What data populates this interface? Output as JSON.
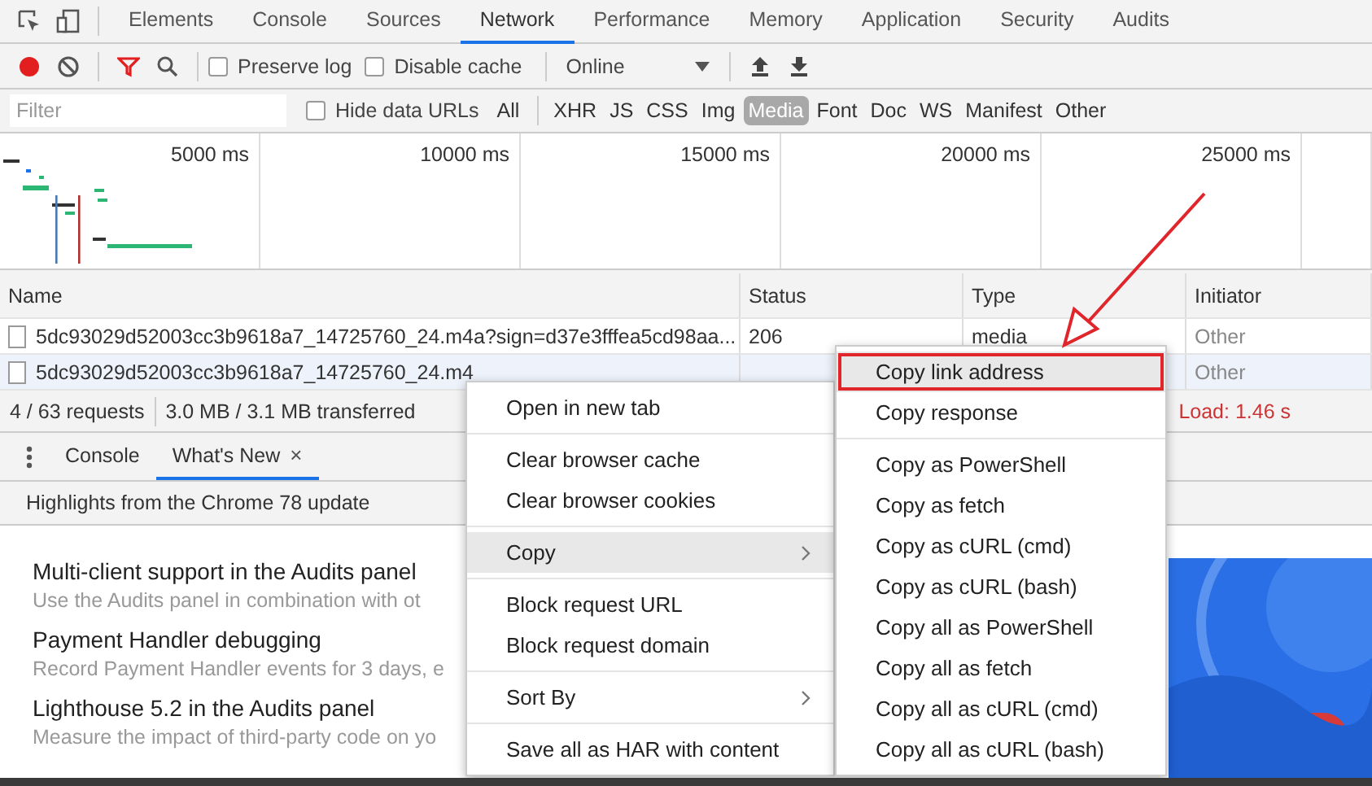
{
  "panel_tabs": [
    {
      "label": "Elements",
      "selected": false
    },
    {
      "label": "Console",
      "selected": false
    },
    {
      "label": "Sources",
      "selected": false
    },
    {
      "label": "Network",
      "selected": true
    },
    {
      "label": "Performance",
      "selected": false
    },
    {
      "label": "Memory",
      "selected": false
    },
    {
      "label": "Application",
      "selected": false
    },
    {
      "label": "Security",
      "selected": false
    },
    {
      "label": "Audits",
      "selected": false
    }
  ],
  "toolbar": {
    "recording": true,
    "checks": [
      {
        "label": "Preserve log",
        "checked": false
      },
      {
        "label": "Disable cache",
        "checked": false
      }
    ],
    "throttling": "Online"
  },
  "filter": {
    "placeholder": "Filter",
    "hide_data_urls": {
      "label": "Hide data URLs",
      "checked": false
    },
    "types": [
      {
        "label": "All",
        "selected": false
      },
      {
        "label": "XHR",
        "selected": false
      },
      {
        "label": "JS",
        "selected": false
      },
      {
        "label": "CSS",
        "selected": false
      },
      {
        "label": "Img",
        "selected": false
      },
      {
        "label": "Media",
        "selected": true
      },
      {
        "label": "Font",
        "selected": false
      },
      {
        "label": "Doc",
        "selected": false
      },
      {
        "label": "WS",
        "selected": false
      },
      {
        "label": "Manifest",
        "selected": false
      },
      {
        "label": "Other",
        "selected": false
      }
    ]
  },
  "overview": {
    "ticks": [
      "5000 ms",
      "10000 ms",
      "15000 ms",
      "20000 ms",
      "25000 ms"
    ]
  },
  "table": {
    "columns": [
      "Name",
      "Status",
      "Type",
      "Initiator"
    ],
    "rows": [
      {
        "name": "5dc93029d52003cc3b9618a7_14725760_24.m4a?sign=d37e3fffea5cd98aa...",
        "status": "206",
        "type": "media",
        "initiator": "Other",
        "selected": false
      },
      {
        "name": "5dc93029d52003cc3b9618a7_14725760_24.m4",
        "initiator": "Other",
        "selected": true
      }
    ]
  },
  "status_bar": {
    "requests": "4 / 63 requests",
    "transferred": "3.0 MB / 3.1 MB transferred",
    "load": "Load: 1.46 s"
  },
  "drawer": {
    "tabs": [
      {
        "label": "Console",
        "selected": false
      },
      {
        "label": "What's New",
        "selected": true,
        "close": "×"
      }
    ],
    "heading": "Highlights from the Chrome 78 update",
    "items": [
      {
        "title": "Multi-client support in the Audits panel",
        "description": "Use the Audits panel in combination with ot"
      },
      {
        "title": "Payment Handler debugging",
        "description": "Record Payment Handler events for 3 days, e"
      },
      {
        "title": "Lighthouse 5.2 in the Audits panel",
        "description": "Measure the impact of third-party code on yo"
      }
    ]
  },
  "context_menu": {
    "groups": [
      [
        {
          "label": "Open in new tab",
          "submenu": false,
          "selected": false
        }
      ],
      [
        {
          "label": "Clear browser cache",
          "submenu": false,
          "selected": false
        },
        {
          "label": "Clear browser cookies",
          "submenu": false,
          "selected": false
        }
      ],
      [
        {
          "label": "Copy",
          "submenu": true,
          "selected": true
        }
      ],
      [
        {
          "label": "Block request URL",
          "submenu": false,
          "selected": false
        },
        {
          "label": "Block request domain",
          "submenu": false,
          "selected": false
        }
      ],
      [
        {
          "label": "Sort By",
          "submenu": true,
          "selected": false
        }
      ],
      [
        {
          "label": "Save all as HAR with content",
          "submenu": false,
          "selected": false
        }
      ]
    ]
  },
  "copy_submenu": {
    "groups": [
      [
        {
          "label": "Copy link address",
          "selected": true,
          "outlined": true
        },
        {
          "label": "Copy response",
          "selected": false,
          "outlined": false
        }
      ],
      [
        {
          "label": "Copy as PowerShell",
          "selected": false,
          "outlined": false
        },
        {
          "label": "Copy as fetch",
          "selected": false,
          "outlined": false
        },
        {
          "label": "Copy as cURL (cmd)",
          "selected": false,
          "outlined": false
        },
        {
          "label": "Copy as cURL (bash)",
          "selected": false,
          "outlined": false
        },
        {
          "label": "Copy all as PowerShell",
          "selected": false,
          "outlined": false
        },
        {
          "label": "Copy all as fetch",
          "selected": false,
          "outlined": false
        },
        {
          "label": "Copy all as cURL (cmd)",
          "selected": false,
          "outlined": false
        },
        {
          "label": "Copy all as cURL (bash)",
          "selected": false,
          "outlined": false
        }
      ]
    ]
  }
}
